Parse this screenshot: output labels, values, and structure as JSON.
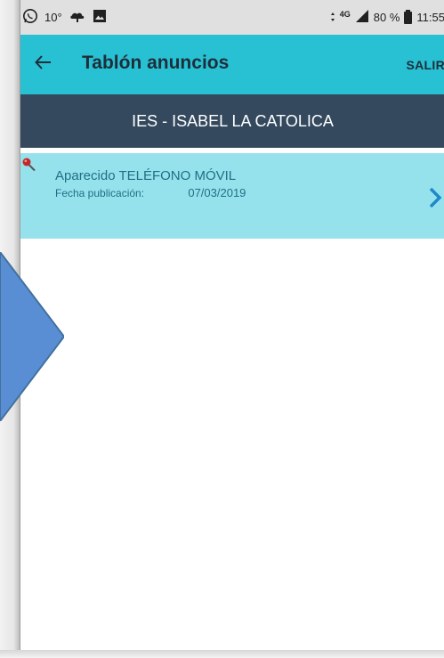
{
  "status_bar": {
    "temperature": "10°",
    "network": "4G",
    "battery": "80 %",
    "time": "11:55"
  },
  "app_bar": {
    "title": "Tablón anuncios",
    "exit_label": "SALIR"
  },
  "school": {
    "name": "IES - ISABEL LA CATOLICA"
  },
  "announcements": [
    {
      "title": "Aparecido TELÉFONO MÓVIL",
      "date_label": "Fecha publicación:",
      "date_value": "07/03/2019"
    }
  ],
  "colors": {
    "app_bar": "#27c1d3",
    "school_bar": "#34495e",
    "list_item": "#96e2ec",
    "arrow": "#5a8ed4"
  },
  "icons": [
    "whatsapp-icon",
    "weather-icon",
    "image-icon",
    "back-arrow-icon",
    "pin-icon",
    "chevron-right-icon"
  ]
}
